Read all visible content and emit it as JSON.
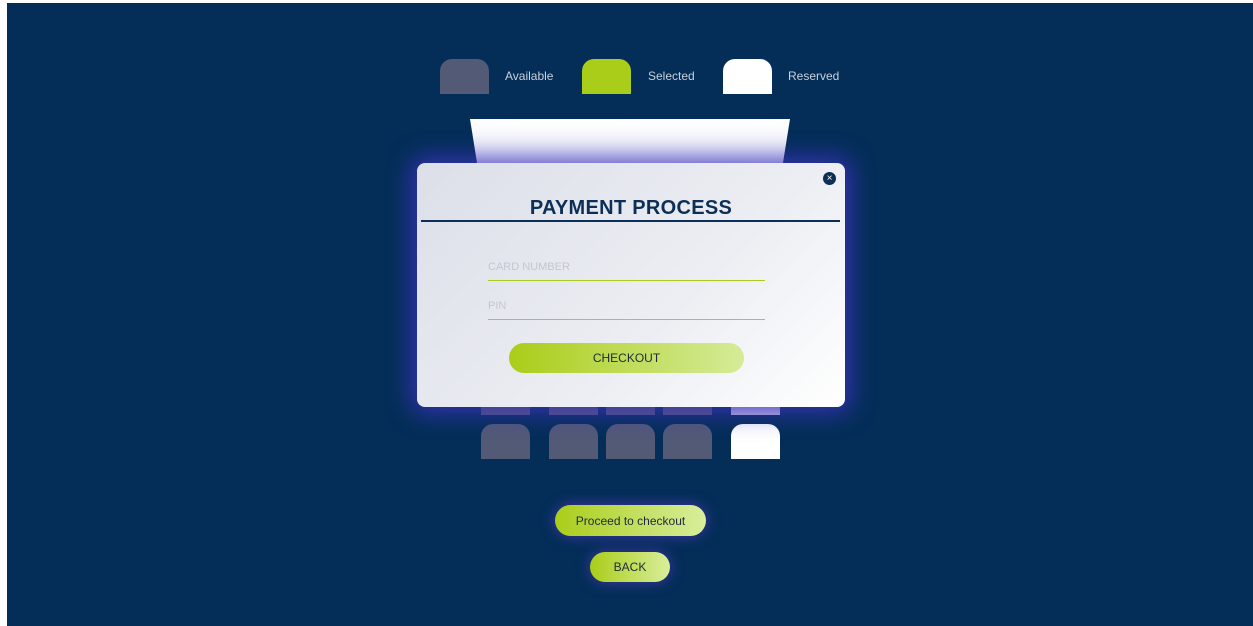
{
  "legend": {
    "available_label": "Available",
    "selected_label": "Selected",
    "reserved_label": "Reserved"
  },
  "modal": {
    "title": "PAYMENT PROCESS",
    "close_icon": "×",
    "card_placeholder": "CARD NUMBER",
    "card_value": "",
    "pin_placeholder": "PIN",
    "pin_value": "",
    "checkout_label": "CHECKOUT"
  },
  "actions": {
    "proceed_label": "Proceed to checkout",
    "back_label": "BACK"
  },
  "colors": {
    "background": "#042e58",
    "available": "#535a76",
    "selected": "#aacd19",
    "reserved": "#ffffff",
    "accent_text": "#0c2f57"
  },
  "seats_visible_bottom_row": [
    "available",
    "available",
    "available",
    "available",
    "reserved"
  ]
}
